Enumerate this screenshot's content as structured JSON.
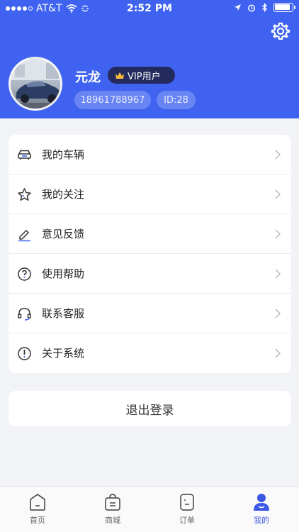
{
  "status_bar": {
    "carrier": "AT&T",
    "time": "2:52 PM",
    "battery_level": 0.9
  },
  "profile": {
    "name": "元龙",
    "vip_label": "VIP用户",
    "phone": "18961788967",
    "user_id": "ID:28"
  },
  "menu": {
    "items": [
      {
        "label": "我的车辆",
        "icon": "car-icon"
      },
      {
        "label": "我的关注",
        "icon": "star-icon"
      },
      {
        "label": "意见反馈",
        "icon": "pen-icon"
      },
      {
        "label": "使用帮助",
        "icon": "question-icon"
      },
      {
        "label": "联系客服",
        "icon": "headset-icon"
      },
      {
        "label": "关于系统",
        "icon": "info-icon"
      }
    ]
  },
  "logout": {
    "label": "退出登录"
  },
  "tabs": [
    {
      "label": "首页",
      "icon": "home-icon",
      "active": false
    },
    {
      "label": "商城",
      "icon": "shop-icon",
      "active": false
    },
    {
      "label": "订单",
      "icon": "order-icon",
      "active": false
    },
    {
      "label": "我的",
      "icon": "profile-icon",
      "active": true
    }
  ],
  "colors": {
    "brand_blue": "#3f63f0",
    "vip_badge": "#232a5e",
    "crown_gold": "#f5b83a",
    "active_tab": "#3a58e4"
  }
}
